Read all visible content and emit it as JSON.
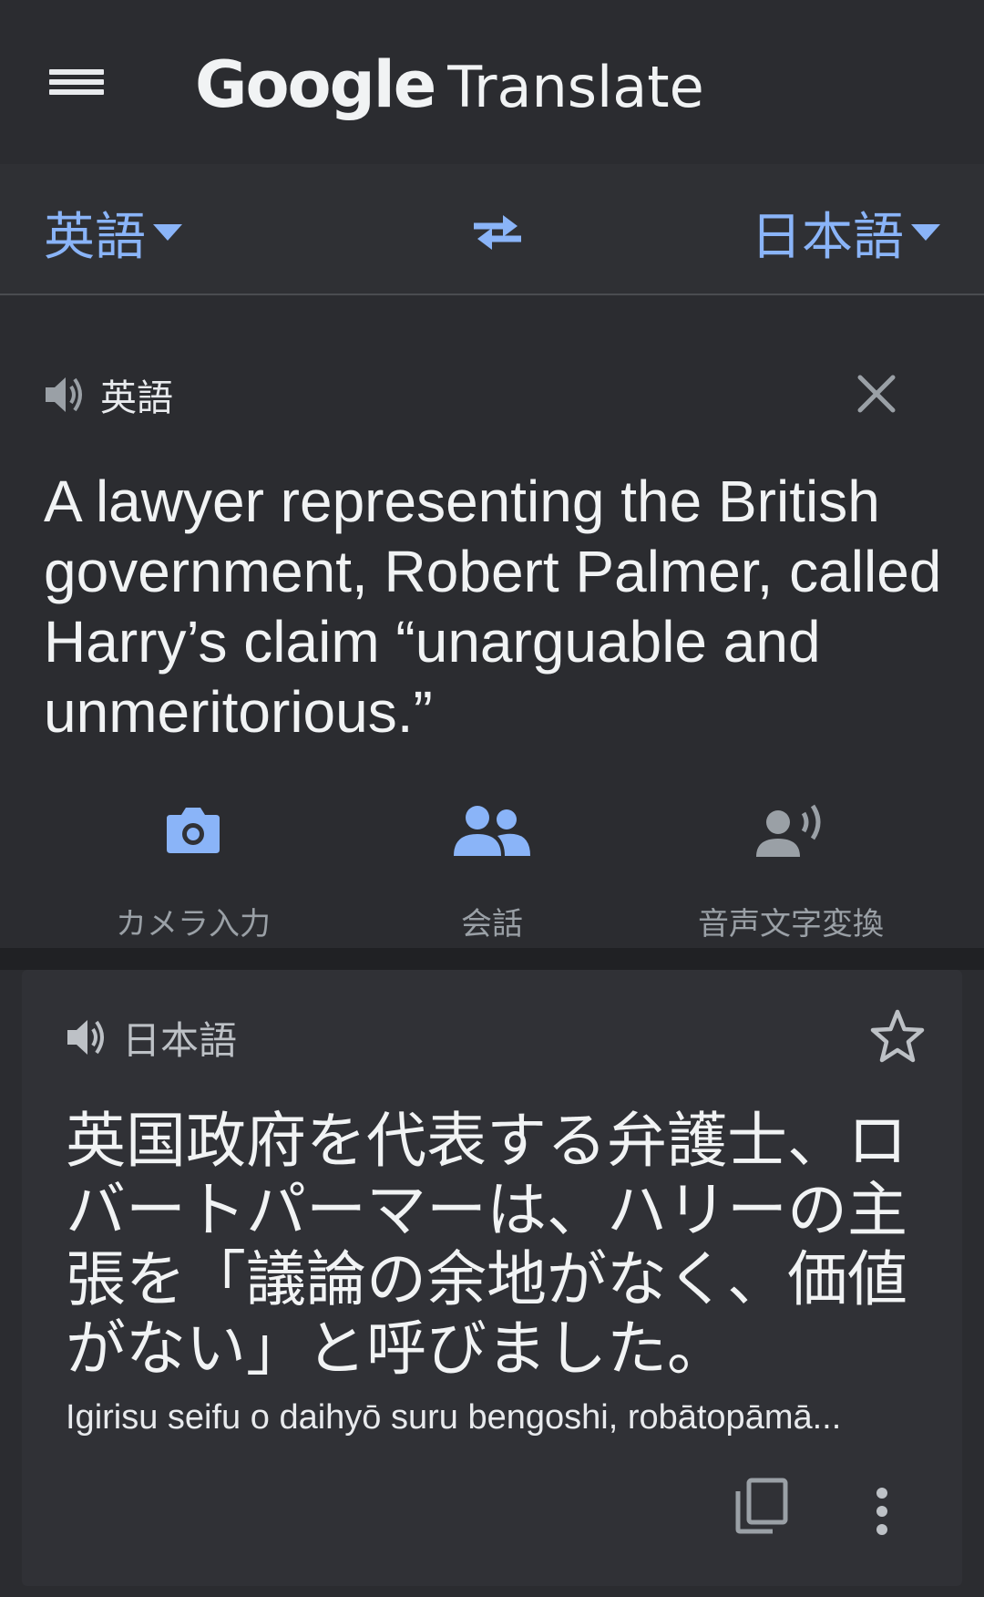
{
  "appbar": {
    "brand_google": "Google",
    "brand_product": "Translate",
    "menu_icon": "menu-icon"
  },
  "language_bar": {
    "source_language": "英語",
    "target_language": "日本語",
    "swap_icon": "swap-arrows-icon",
    "accent_color": "#8ab4f8"
  },
  "source": {
    "language_label": "英語",
    "text": "A lawyer representing the British government, Robert Palmer, called Harry’s claim “unarguable and unmeritorious.”",
    "speaker_icon": "speaker-icon",
    "clear_icon": "close-icon"
  },
  "input_tools": [
    {
      "label": "カメラ入力",
      "icon": "camera-icon",
      "color": "#8ab4f8"
    },
    {
      "label": "会話",
      "icon": "people-icon",
      "color": "#8ab4f8"
    },
    {
      "label": "音声文字変換",
      "icon": "voice-transcribe-icon",
      "color": "#9aa0a6"
    }
  ],
  "result": {
    "language_label": "日本語",
    "text": "英国政府を代表する弁護士、ロバートパーマーは、ハリーの主張を「議論の余地がなく、価値がない」と呼びました。",
    "romanization": "Igirisu seifu o daihyō suru bengoshi, robātopāmā...",
    "star_icon": "star-outline-icon",
    "copy_icon": "copy-icon",
    "more_icon": "more-vert-icon"
  }
}
